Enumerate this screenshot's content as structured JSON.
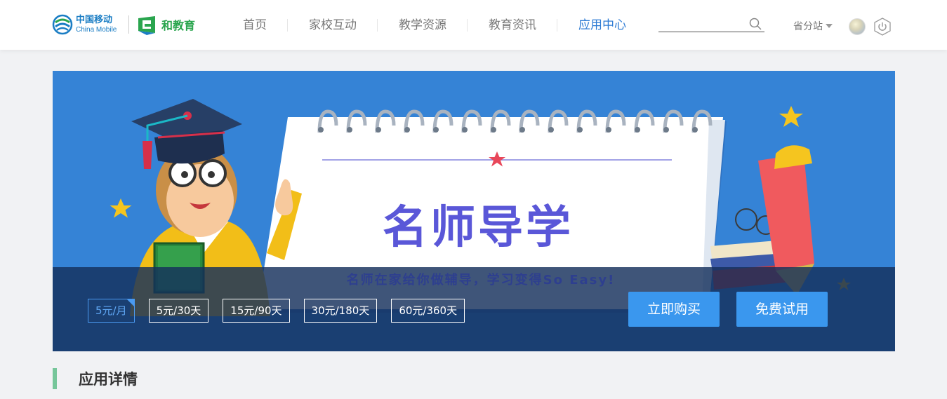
{
  "brand": {
    "china_mobile_cn": "中国移动",
    "china_mobile_en": "China Mobile",
    "product_name": "和教育",
    "colors": {
      "china_mobile": "#1a7dc4",
      "he_edu": "#2aa54e"
    }
  },
  "nav": {
    "items": [
      {
        "label": "首页"
      },
      {
        "label": "家校互动"
      },
      {
        "label": "教学资源"
      },
      {
        "label": "教育资讯"
      },
      {
        "label": "应用中心"
      }
    ],
    "active_index": 4
  },
  "search": {
    "placeholder": "",
    "value": ""
  },
  "province": {
    "label": "省分站"
  },
  "banner": {
    "title": "名师导学",
    "slogan": "名师在家给你做辅导，学习变得So Easy!",
    "prices": [
      {
        "label": "5元/月"
      },
      {
        "label": "5元/30天"
      },
      {
        "label": "15元/90天"
      },
      {
        "label": "30元/180天"
      },
      {
        "label": "60元/360天"
      }
    ],
    "selected_price_index": 0,
    "buy_label": "立即购买",
    "trial_label": "免费试用",
    "colors": {
      "background": "#3583d6",
      "button": "#3a97ee",
      "title": "#5a57d8"
    }
  },
  "section": {
    "title": "应用详情",
    "accent": "#76c69a"
  }
}
